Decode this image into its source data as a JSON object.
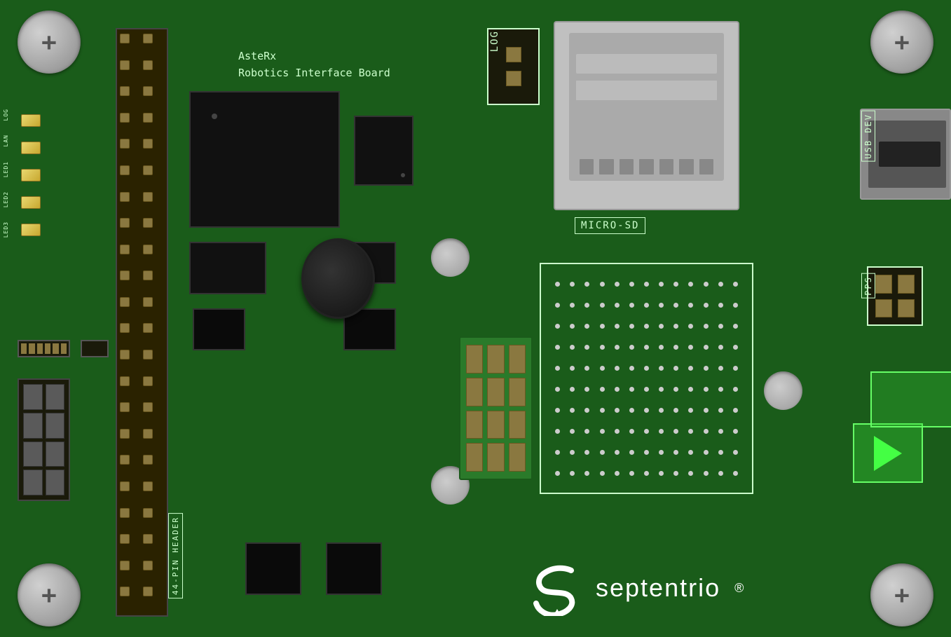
{
  "board": {
    "title": "AsteRx Robotics Interface Board",
    "title_line1": "AsteRx",
    "title_line2": "Robotics Interface Board",
    "bg_color": "#1a5c1a",
    "header_label": "44-PIN\nHEADER",
    "log_label": "LOG",
    "microsd_label": "MICRO-SD",
    "usb_dev_label": "USB DEV",
    "pps_label": "PPS",
    "septentrio_name": "septentrio",
    "septentrio_trademark": "®"
  },
  "leds": [
    {
      "id": "log",
      "label": "LOG"
    },
    {
      "id": "lan",
      "label": "LAN"
    },
    {
      "id": "led1",
      "label": "LED1"
    },
    {
      "id": "led2",
      "label": "LED2"
    },
    {
      "id": "led3",
      "label": "LED3"
    }
  ]
}
